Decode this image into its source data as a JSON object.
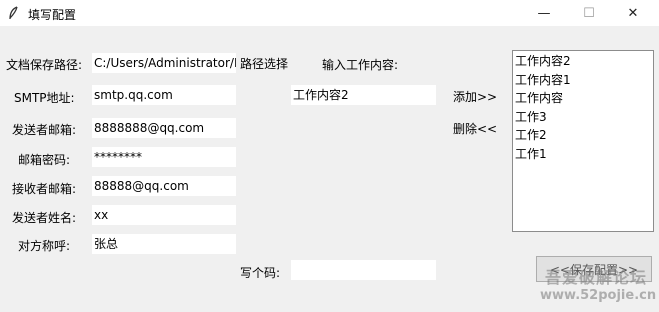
{
  "window": {
    "title": "填写配置",
    "icon": "feather-icon",
    "minimize_glyph": "—",
    "maximize_glyph": "☐",
    "close_glyph": "✕"
  },
  "form": {
    "path_label": "文档保存路径:",
    "path_value": "C:/Users/Administrator/De",
    "path_button": "路径选择",
    "smtp_label": "SMTP地址:",
    "smtp_value": "smtp.qq.com",
    "sender_email_label": "发送者邮箱:",
    "sender_email_value": "8888888@qq.com",
    "password_label": "邮箱密码:",
    "password_value": "********",
    "receiver_email_label": "接收者邮箱:",
    "receiver_email_value": "88888@qq.com",
    "sender_name_label": "发送者姓名:",
    "sender_name_value": "xx",
    "recipient_title_label": "对方称呼:",
    "recipient_title_value": "张总"
  },
  "work": {
    "input_label": "输入工作内容:",
    "input_value": "工作内容2",
    "add_button": "添加>>",
    "delete_button": "删除<<",
    "items": [
      "工作内容2",
      "工作内容1",
      "工作内容",
      "工作3",
      "工作2",
      "工作1"
    ]
  },
  "code": {
    "label": "写个码:",
    "value": ""
  },
  "save_button": "<<保存配置>>",
  "watermark": {
    "line1": "吾爱破解论坛",
    "line2": "www.52pojie.cn"
  }
}
